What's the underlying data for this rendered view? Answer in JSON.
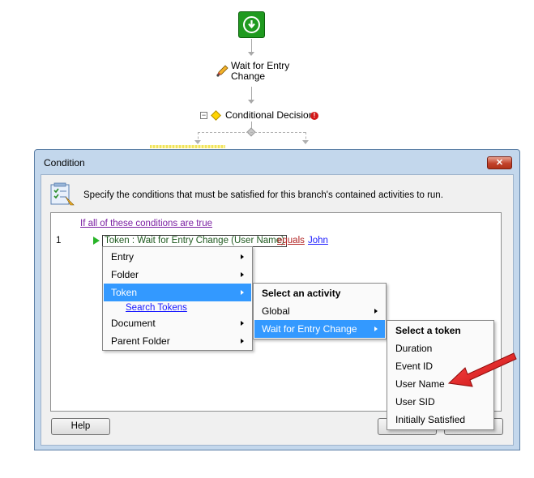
{
  "workflow": {
    "activity1_line1": "Wait for Entry",
    "activity1_line2": "Change",
    "decision_label": "Conditional Decision",
    "error_glyph": "!"
  },
  "dialog": {
    "title": "Condition",
    "close_glyph": "✕",
    "description": "Specify the conditions that must be satisfied for this branch's contained activities to run.",
    "condition_header": "If all of these conditions are true",
    "row": {
      "index": "1",
      "token": "Token : Wait for Entry Change (User Name)",
      "operator": "equals",
      "value": "John"
    },
    "help_label": "Help"
  },
  "menus": {
    "main": [
      {
        "label": "Entry",
        "submenu": true
      },
      {
        "label": "Folder",
        "submenu": true
      },
      {
        "label": "Token",
        "submenu": true,
        "selected": true
      },
      {
        "label": "Search Tokens",
        "link": true
      },
      {
        "label": "Document",
        "submenu": true
      },
      {
        "label": "Parent Folder",
        "submenu": true
      }
    ],
    "activity": {
      "header": "Select an activity",
      "items": [
        {
          "label": "Global",
          "submenu": true
        },
        {
          "label": "Wait for Entry Change",
          "submenu": true,
          "selected": true
        }
      ]
    },
    "token": {
      "header": "Select a token",
      "items": [
        "Duration",
        "Event ID",
        "User Name",
        "User SID",
        "Initially Satisfied"
      ]
    }
  },
  "colors": {
    "selection": "#3399ff",
    "start_node": "#1f9a1f",
    "callout_arrow": "#e01b1b"
  },
  "icons": [
    "download-arrow-icon",
    "pencil-icon",
    "collapse-icon",
    "diamond-decision-icon",
    "error-icon",
    "checklist-icon",
    "play-icon",
    "close-icon",
    "chevron-right-icon",
    "red-arrow-icon"
  ]
}
